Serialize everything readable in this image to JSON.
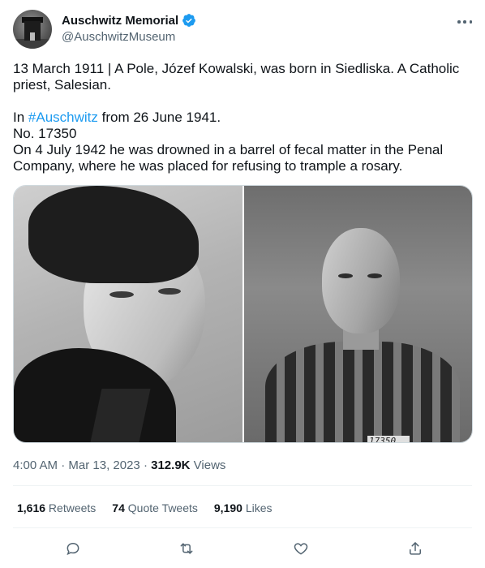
{
  "author": {
    "display_name": "Auschwitz Memorial",
    "handle": "@AuschwitzMuseum",
    "verified_color": "#1d9bf0"
  },
  "tweet": {
    "line1": "13 March 1911 | A Pole, Józef Kowalski, was born in Siedliska. A Catholic priest, Salesian.",
    "line2_prefix": "In ",
    "hashtag": "#Auschwitz",
    "line2_suffix": " from 26 June 1941.",
    "line3": "No. 17350",
    "line4": "On 4 July 1942 he was drowned in a barrel of fecal matter in the Penal Company, where he was placed for refusing to trample a rosary."
  },
  "media": {
    "right_photo_tag": "17350"
  },
  "meta": {
    "time": "4:00 AM",
    "separator1": " · ",
    "date": "Mar 13, 2023",
    "separator2": " · ",
    "views_count": "312.9K",
    "views_label": " Views"
  },
  "stats": {
    "retweets_count": "1,616",
    "retweets_label": " Retweets",
    "quotes_count": "74",
    "quotes_label": " Quote Tweets",
    "likes_count": "9,190",
    "likes_label": " Likes"
  },
  "actions": {
    "icons": [
      "reply-icon",
      "retweet-icon",
      "like-icon",
      "share-icon"
    ],
    "icon_color": "#536471"
  },
  "colors": {
    "link": "#1d9bf0",
    "text": "#0f1419",
    "secondary": "#536471"
  }
}
